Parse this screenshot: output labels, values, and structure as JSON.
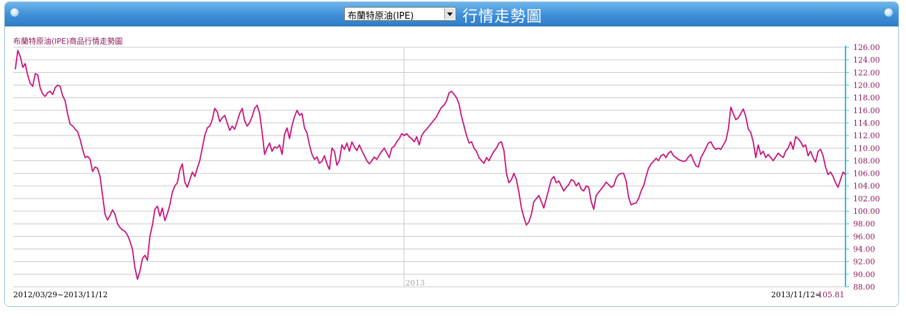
{
  "header": {
    "product_select": "布蘭特原油(IPE)",
    "title": "行情走勢圖"
  },
  "footer": {
    "date_range": "2012/03/29~2013/11/12",
    "last_label": "2013/11/12=",
    "last_value": "105.81"
  },
  "colors": {
    "line": "#c8137a",
    "axis": "#22c4d4",
    "label": "#8b1a5a"
  },
  "chart_data": {
    "type": "line",
    "title": "布蘭特原油(IPE)商品行情走勢圖",
    "ylim": [
      88,
      126
    ],
    "y_ticks": [
      "126.00",
      "124.00",
      "122.00",
      "120.00",
      "118.00",
      "116.00",
      "114.00",
      "112.00",
      "110.00",
      "108.00",
      "106.00",
      "104.00",
      "102.00",
      "100.00",
      "98.00",
      "96.00",
      "94.00",
      "92.00",
      "90.00",
      "88.00"
    ],
    "x_marker": "2013",
    "series": [
      {
        "values": [
          122.5,
          125.5,
          124.5,
          122.8,
          123.4,
          121.5,
          120.3,
          119.8,
          121.8,
          121.6,
          119.5,
          118.6,
          118.2,
          118.8,
          119.0,
          118.5,
          119.6,
          120.0,
          119.8,
          118.3,
          117.5,
          115.4,
          113.8,
          113.5,
          113.0,
          112.6,
          111.4,
          109.8,
          108.5,
          108.7,
          108.2,
          106.3,
          107.0,
          106.8,
          105.5,
          102.5,
          99.5,
          98.6,
          99.3,
          100.2,
          99.5,
          98.0,
          97.4,
          97.0,
          96.8,
          96.2,
          95.2,
          94.0,
          91.0,
          89.2,
          90.5,
          92.5,
          93.0,
          92.2,
          96.0,
          97.8,
          100.3,
          100.8,
          99.2,
          100.5,
          98.5,
          99.6,
          101.0,
          103.0,
          104.0,
          104.5,
          106.5,
          107.5,
          104.6,
          103.8,
          105.0,
          106.2,
          105.5,
          106.8,
          108.0,
          110.0,
          112.0,
          113.2,
          113.5,
          114.5,
          116.3,
          115.8,
          114.2,
          114.8,
          115.2,
          114.0,
          112.8,
          113.5,
          113.0,
          114.2,
          115.5,
          116.3,
          114.3,
          113.5,
          114.0,
          115.0,
          116.3,
          116.8,
          115.5,
          112.5,
          109.0,
          110.0,
          110.8,
          109.5,
          110.2,
          110.0,
          110.5,
          109.0,
          112.2,
          113.2,
          111.5,
          113.6,
          115.0,
          116.0,
          115.2,
          115.5,
          113.2,
          112.4,
          110.5,
          109.0,
          108.2,
          108.6,
          107.6,
          107.9,
          108.8,
          107.5,
          106.6,
          110.0,
          109.5,
          107.3,
          108.0,
          110.5,
          109.8,
          110.8,
          109.5,
          111.0,
          110.2,
          109.6,
          110.5,
          109.6,
          108.8,
          108.0,
          107.5,
          108.0,
          108.6,
          108.2,
          108.9,
          109.5,
          110.0,
          109.2,
          108.5,
          110.0,
          110.3,
          111.0,
          111.5,
          112.3,
          112.0,
          112.3,
          111.8,
          111.5,
          111.0,
          111.8,
          110.5,
          112.0,
          112.6,
          113.0,
          113.5,
          114.0,
          114.5,
          115.0,
          115.8,
          116.5,
          116.8,
          117.5,
          118.8,
          119.0,
          118.5,
          118.0,
          117.0,
          115.0,
          113.5,
          112.0,
          110.8,
          111.0,
          110.0,
          109.5,
          108.5,
          108.0,
          107.6,
          108.5,
          108.0,
          108.8,
          109.5,
          110.0,
          110.8,
          111.0,
          109.6,
          106.0,
          104.5,
          105.0,
          106.0,
          105.0,
          103.0,
          100.5,
          99.0,
          97.8,
          98.3,
          99.5,
          101.5,
          102.0,
          102.5,
          101.5,
          100.5,
          102.0,
          103.5,
          105.0,
          105.5,
          104.5,
          104.8,
          104.0,
          103.2,
          103.8,
          104.2,
          105.0,
          104.8,
          104.0,
          104.5,
          103.5,
          103.2,
          104.0,
          103.8,
          101.5,
          100.3,
          102.5,
          103.0,
          103.5,
          104.0,
          104.6,
          104.2,
          103.8,
          104.0,
          105.2,
          105.8,
          106.0,
          106.0,
          104.8,
          102.2,
          101.0,
          101.2,
          101.3,
          102.0,
          103.2,
          104.0,
          105.5,
          106.8,
          107.5,
          107.9,
          108.4,
          108.0,
          108.8,
          109.0,
          108.5,
          109.2,
          109.5,
          108.8,
          108.5,
          108.2,
          108.0,
          107.9,
          108.0,
          108.6,
          109.0,
          108.0,
          107.2,
          107.0,
          108.5,
          109.2,
          110.0,
          110.8,
          111.0,
          110.2,
          109.8,
          110.0,
          109.8,
          110.5,
          111.2,
          113.0,
          116.5,
          115.5,
          114.5,
          114.8,
          115.5,
          116.2,
          115.0,
          113.0,
          112.5,
          111.0,
          108.5,
          110.5,
          109.0,
          109.5,
          108.5,
          109.0,
          108.5,
          108.0,
          108.6,
          109.2,
          108.8,
          108.5,
          109.5,
          110.0,
          111.0,
          109.8,
          111.8,
          111.5,
          111.0,
          110.2,
          110.5,
          108.8,
          109.5,
          108.5,
          107.8,
          109.5,
          109.8,
          108.8,
          107.0,
          105.8,
          106.2,
          105.5,
          104.5,
          103.8,
          105.0,
          106.2,
          105.81
        ]
      }
    ]
  }
}
